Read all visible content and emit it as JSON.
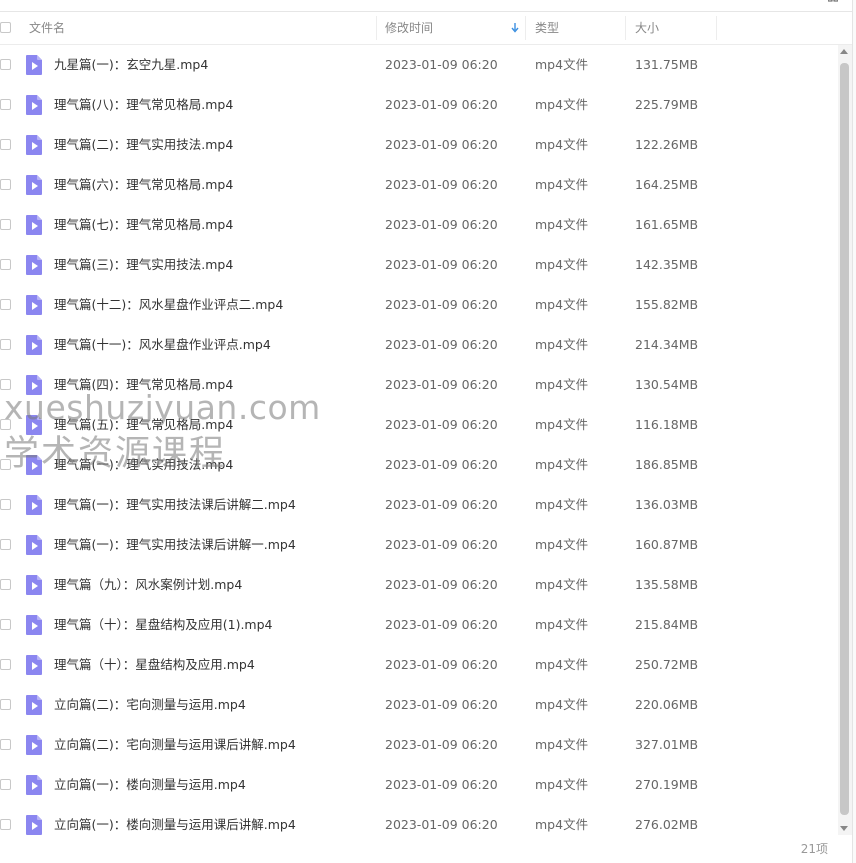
{
  "header": {
    "name_label": "文件名",
    "modified_label": "修改时间",
    "type_label": "类型",
    "size_label": "大小"
  },
  "colors": {
    "file_icon": "#8b86f0",
    "sort_arrow": "#3b8fe0"
  },
  "files": [
    {
      "name": "九星篇(一)：玄空九星.mp4",
      "date": "2023-01-09 06:20",
      "type": "mp4文件",
      "size": "131.75MB"
    },
    {
      "name": "理气篇(八)：理气常见格局.mp4",
      "date": "2023-01-09 06:20",
      "type": "mp4文件",
      "size": "225.79MB"
    },
    {
      "name": "理气篇(二)：理气实用技法.mp4",
      "date": "2023-01-09 06:20",
      "type": "mp4文件",
      "size": "122.26MB"
    },
    {
      "name": "理气篇(六)：理气常见格局.mp4",
      "date": "2023-01-09 06:20",
      "type": "mp4文件",
      "size": "164.25MB"
    },
    {
      "name": "理气篇(七)：理气常见格局.mp4",
      "date": "2023-01-09 06:20",
      "type": "mp4文件",
      "size": "161.65MB"
    },
    {
      "name": "理气篇(三)：理气实用技法.mp4",
      "date": "2023-01-09 06:20",
      "type": "mp4文件",
      "size": "142.35MB"
    },
    {
      "name": "理气篇(十二)：风水星盘作业评点二.mp4",
      "date": "2023-01-09 06:20",
      "type": "mp4文件",
      "size": "155.82MB"
    },
    {
      "name": "理气篇(十一)：风水星盘作业评点.mp4",
      "date": "2023-01-09 06:20",
      "type": "mp4文件",
      "size": "214.34MB"
    },
    {
      "name": "理气篇(四)：理气常见格局.mp4",
      "date": "2023-01-09 06:20",
      "type": "mp4文件",
      "size": "130.54MB"
    },
    {
      "name": "理气篇(五)：理气常见格局.mp4",
      "date": "2023-01-09 06:20",
      "type": "mp4文件",
      "size": "116.18MB"
    },
    {
      "name": "理气篇(一)：理气实用技法.mp4",
      "date": "2023-01-09 06:20",
      "type": "mp4文件",
      "size": "186.85MB"
    },
    {
      "name": "理气篇(一)：理气实用技法课后讲解二.mp4",
      "date": "2023-01-09 06:20",
      "type": "mp4文件",
      "size": "136.03MB"
    },
    {
      "name": "理气篇(一)：理气实用技法课后讲解一.mp4",
      "date": "2023-01-09 06:20",
      "type": "mp4文件",
      "size": "160.87MB"
    },
    {
      "name": "理气篇（九）：风水案例计划.mp4",
      "date": "2023-01-09 06:20",
      "type": "mp4文件",
      "size": "135.58MB"
    },
    {
      "name": "理气篇（十）：星盘结构及应用(1).mp4",
      "date": "2023-01-09 06:20",
      "type": "mp4文件",
      "size": "215.84MB"
    },
    {
      "name": "理气篇（十）：星盘结构及应用.mp4",
      "date": "2023-01-09 06:20",
      "type": "mp4文件",
      "size": "250.72MB"
    },
    {
      "name": "立向篇(二)：宅向测量与运用.mp4",
      "date": "2023-01-09 06:20",
      "type": "mp4文件",
      "size": "220.06MB"
    },
    {
      "name": "立向篇(二)：宅向测量与运用课后讲解.mp4",
      "date": "2023-01-09 06:20",
      "type": "mp4文件",
      "size": "327.01MB"
    },
    {
      "name": "立向篇(一)：楼向测量与运用.mp4",
      "date": "2023-01-09 06:20",
      "type": "mp4文件",
      "size": "270.19MB"
    },
    {
      "name": "立向篇(一)：楼向测量与运用课后讲解.mp4",
      "date": "2023-01-09 06:20",
      "type": "mp4文件",
      "size": "276.02MB"
    }
  ],
  "footer": {
    "count_label": "21项"
  },
  "watermark": {
    "line1": "xueshuziyuan.com",
    "line2": "学术资源课程"
  }
}
